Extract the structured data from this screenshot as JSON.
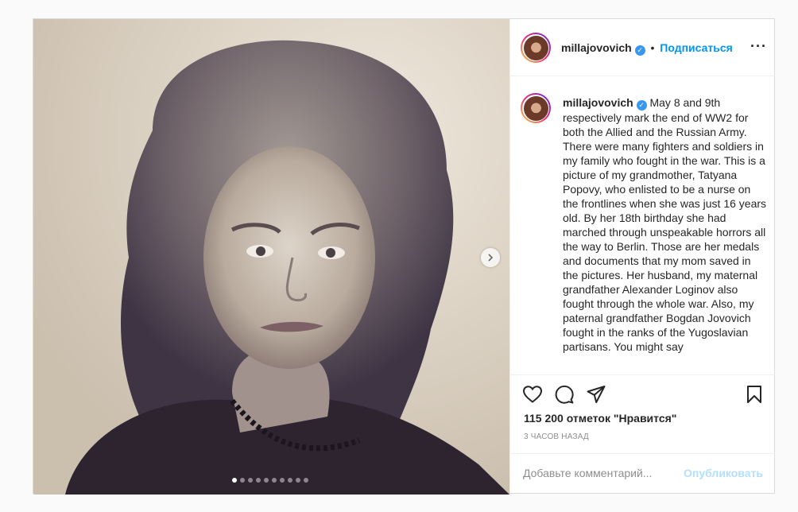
{
  "header": {
    "username": "millajovovich",
    "separator": "•",
    "follow_label": "Подписаться",
    "more_label": "···"
  },
  "caption": {
    "username": "millajovovich",
    "text": "May 8 and 9th respectively mark the end of WW2 for both the Allied and the Russian Army. There were many fighters and soldiers in my family who fought in the war. This is a picture of my grandmother, Tatyana Popovy, who enlisted to be a nurse on the frontlines when she was just 16 years old. By her 18th birthday she had marched through unspeakable horrors all the way to Berlin. Those are her medals and documents that my mom saved in the pictures. Her husband, my maternal grandfather Alexander Loginov also fought through the whole war. Also, my paternal grandfather Bogdan Jovovich fought in the ranks of the Yugoslavian partisans. You might say"
  },
  "likes": "115 200 отметок \"Нравится\"",
  "timestamp": "3 часов назад",
  "comment": {
    "placeholder": "Добавьте комментарий...",
    "publish_label": "Опубликовать"
  },
  "carousel": {
    "total": 10,
    "current": 1
  },
  "icons": [
    "heart-icon",
    "comment-icon",
    "share-icon",
    "bookmark-icon",
    "chevron-right-icon",
    "verified-badge-icon"
  ],
  "colors": {
    "accent": "#0095f6",
    "publish_disabled": "#b2dffc",
    "verified": "#3897f0",
    "muted": "#8e8e8e"
  }
}
